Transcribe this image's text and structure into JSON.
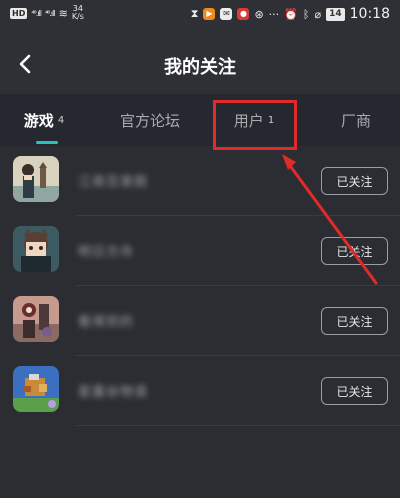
{
  "status_bar": {
    "hd": "HD",
    "signal1": "⁴⁶.ıll",
    "signal2": "⁴⁶.ıll",
    "speed_top": "34",
    "speed_bottom": "K/s",
    "battery": "14",
    "time": "10:18",
    "colors": {
      "app_orange": "#f08a1c",
      "app_red": "#d83b3b",
      "app_white": "#ececec"
    }
  },
  "header": {
    "title": "我的关注"
  },
  "tabs": [
    {
      "label": "游戏",
      "count": "4",
      "active": true
    },
    {
      "label": "官方论坛",
      "count": "",
      "active": false
    },
    {
      "label": "用户",
      "count": "1",
      "active": false
    },
    {
      "label": "厂商",
      "count": "",
      "active": false
    }
  ],
  "follow_list": {
    "button_label": "已关注",
    "items": [
      {
        "name": "江南百景图",
        "icon": "game-icon-jiangnan"
      },
      {
        "name": "明日方舟",
        "icon": "game-icon-arknights"
      },
      {
        "name": "看得到的",
        "icon": "game-icon-mech"
      },
      {
        "name": "星露谷物语",
        "icon": "game-icon-stardew"
      }
    ]
  },
  "annotation": {
    "color": "#e22a2a"
  }
}
